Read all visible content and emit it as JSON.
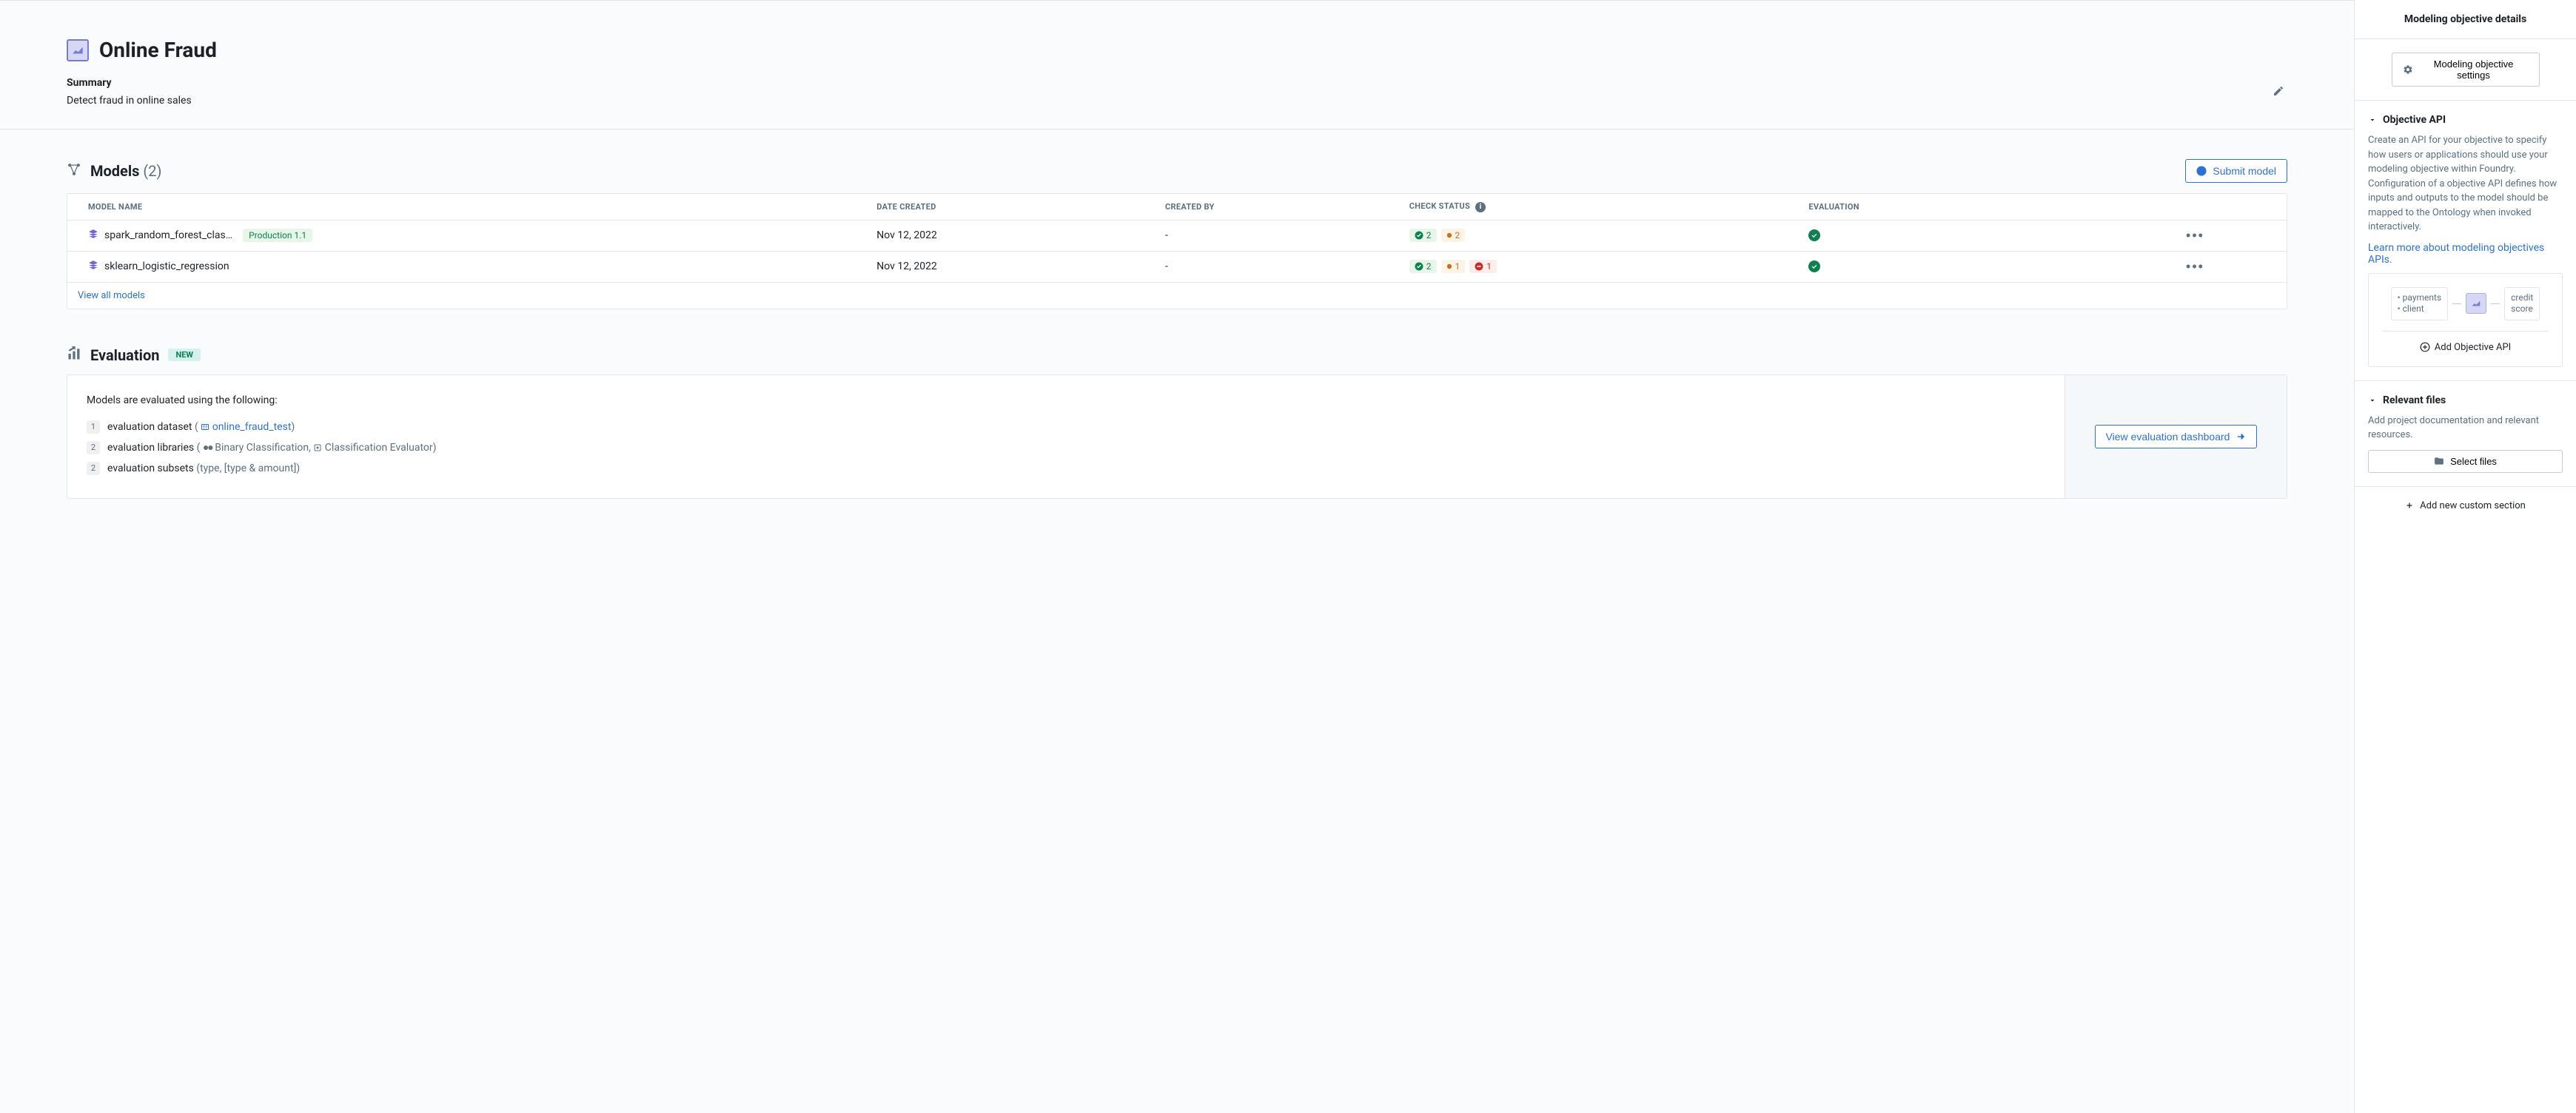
{
  "header": {
    "title": "Online Fraud",
    "summary_label": "Summary",
    "summary_text": "Detect fraud in online sales"
  },
  "models": {
    "title": "Models",
    "count": "(2)",
    "submit_label": "Submit model",
    "columns": {
      "name": "MODEL NAME",
      "date": "DATE CREATED",
      "createdBy": "CREATED BY",
      "checkStatus": "CHECK STATUS",
      "evaluation": "EVALUATION"
    },
    "rows": [
      {
        "name": "spark_random_forest_clas…",
        "tag": "Production 1.1",
        "date": "Nov 12, 2022",
        "createdBy": "-",
        "checks": {
          "green": "2",
          "orange": "2",
          "red": null
        }
      },
      {
        "name": "sklearn_logistic_regression",
        "tag": null,
        "date": "Nov 12, 2022",
        "createdBy": "-",
        "checks": {
          "green": "2",
          "orange": "1",
          "red": "1"
        }
      }
    ],
    "view_all": "View all models"
  },
  "evaluation": {
    "title": "Evaluation",
    "badge": "NEW",
    "intro": "Models are evaluated using the following:",
    "items": [
      {
        "num": "1",
        "label": "evaluation dataset",
        "paren_pre": "(",
        "link": "online_fraud_test",
        "paren_post": ")"
      },
      {
        "num": "2",
        "label": "evaluation libraries",
        "paren_pre": "(",
        "text1": "Binary Classification, ",
        "text2": "Classification Evaluator)",
        "paren_post": ""
      },
      {
        "num": "2",
        "label": "evaluation subsets",
        "paren_pre": "(type, [type & amount])",
        "paren_post": ""
      }
    ],
    "dashboard_btn": "View evaluation dashboard"
  },
  "panel": {
    "title": "Modeling objective details",
    "settings_btn": "Modeling objective settings",
    "api": {
      "title": "Objective API",
      "desc": "Create an API for your objective to specify how users or applications should use your modeling objective within Foundry. Configuration of a objective API defines how inputs and outputs to the model should be mapped to the Ontology when invoked interactively.",
      "learn_more": "Learn more about modeling objectives APIs.",
      "diagram_left1": "• payments",
      "diagram_left2": "• client",
      "diagram_right1": "credit",
      "diagram_right2": "score",
      "add_btn": "Add Objective API"
    },
    "files": {
      "title": "Relevant files",
      "desc": "Add project documentation and relevant resources.",
      "select_btn": "Select files"
    },
    "add_custom": "Add new custom section"
  }
}
